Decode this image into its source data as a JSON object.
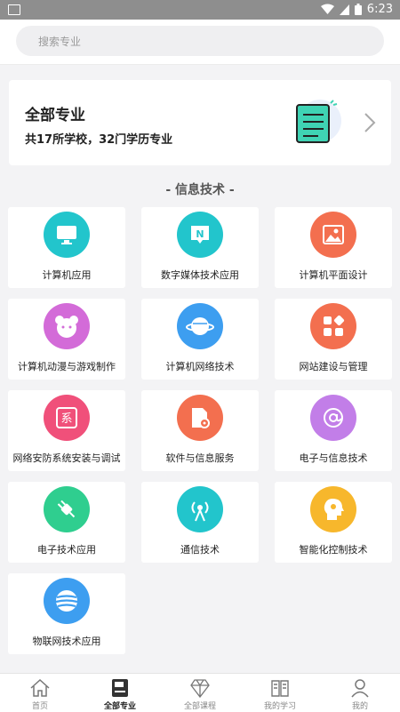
{
  "status_bar": {
    "time": "6:23"
  },
  "search": {
    "placeholder": "搜索专业"
  },
  "banner": {
    "title": "全部专业",
    "subtitle": "共17所学校，32门学历专业"
  },
  "section": {
    "title": "- 信息技术 -"
  },
  "majors": [
    {
      "label": "计算机应用",
      "icon": "monitor-icon",
      "color": "#22c5cc"
    },
    {
      "label": "数字媒体技术应用",
      "icon": "n-bubble-icon",
      "color": "#22c5cc"
    },
    {
      "label": "计算机平面设计",
      "icon": "image-icon",
      "color": "#f36f4f"
    },
    {
      "label": "计算机动漫与游戏制作",
      "icon": "bear-icon",
      "color": "#d36bd8"
    },
    {
      "label": "计算机网络技术",
      "icon": "planet-icon",
      "color": "#3d9ef0"
    },
    {
      "label": "网站建设与管理",
      "icon": "apps-icon",
      "color": "#f36f4f"
    },
    {
      "label": "网络安防系统安装与调试",
      "icon": "system-icon",
      "color": "#f0507a"
    },
    {
      "label": "软件与信息服务",
      "icon": "file-gear-icon",
      "color": "#f36f4f"
    },
    {
      "label": "电子与信息技术",
      "icon": "at-icon",
      "color": "#c27ee8"
    },
    {
      "label": "电子技术应用",
      "icon": "plug-icon",
      "color": "#2fce8f"
    },
    {
      "label": "通信技术",
      "icon": "antenna-icon",
      "color": "#22c5cc"
    },
    {
      "label": "智能化控制技术",
      "icon": "brain-icon",
      "color": "#f7b72c"
    },
    {
      "label": "物联网技术应用",
      "icon": "globe-icon",
      "color": "#3d9ef0"
    }
  ],
  "tabs": [
    {
      "label": "首页",
      "icon": "home-icon"
    },
    {
      "label": "全部专业",
      "icon": "book-icon",
      "active": true
    },
    {
      "label": "全部课程",
      "icon": "diamond-icon"
    },
    {
      "label": "我的学习",
      "icon": "open-book-icon"
    },
    {
      "label": "我的",
      "icon": "person-icon"
    }
  ]
}
